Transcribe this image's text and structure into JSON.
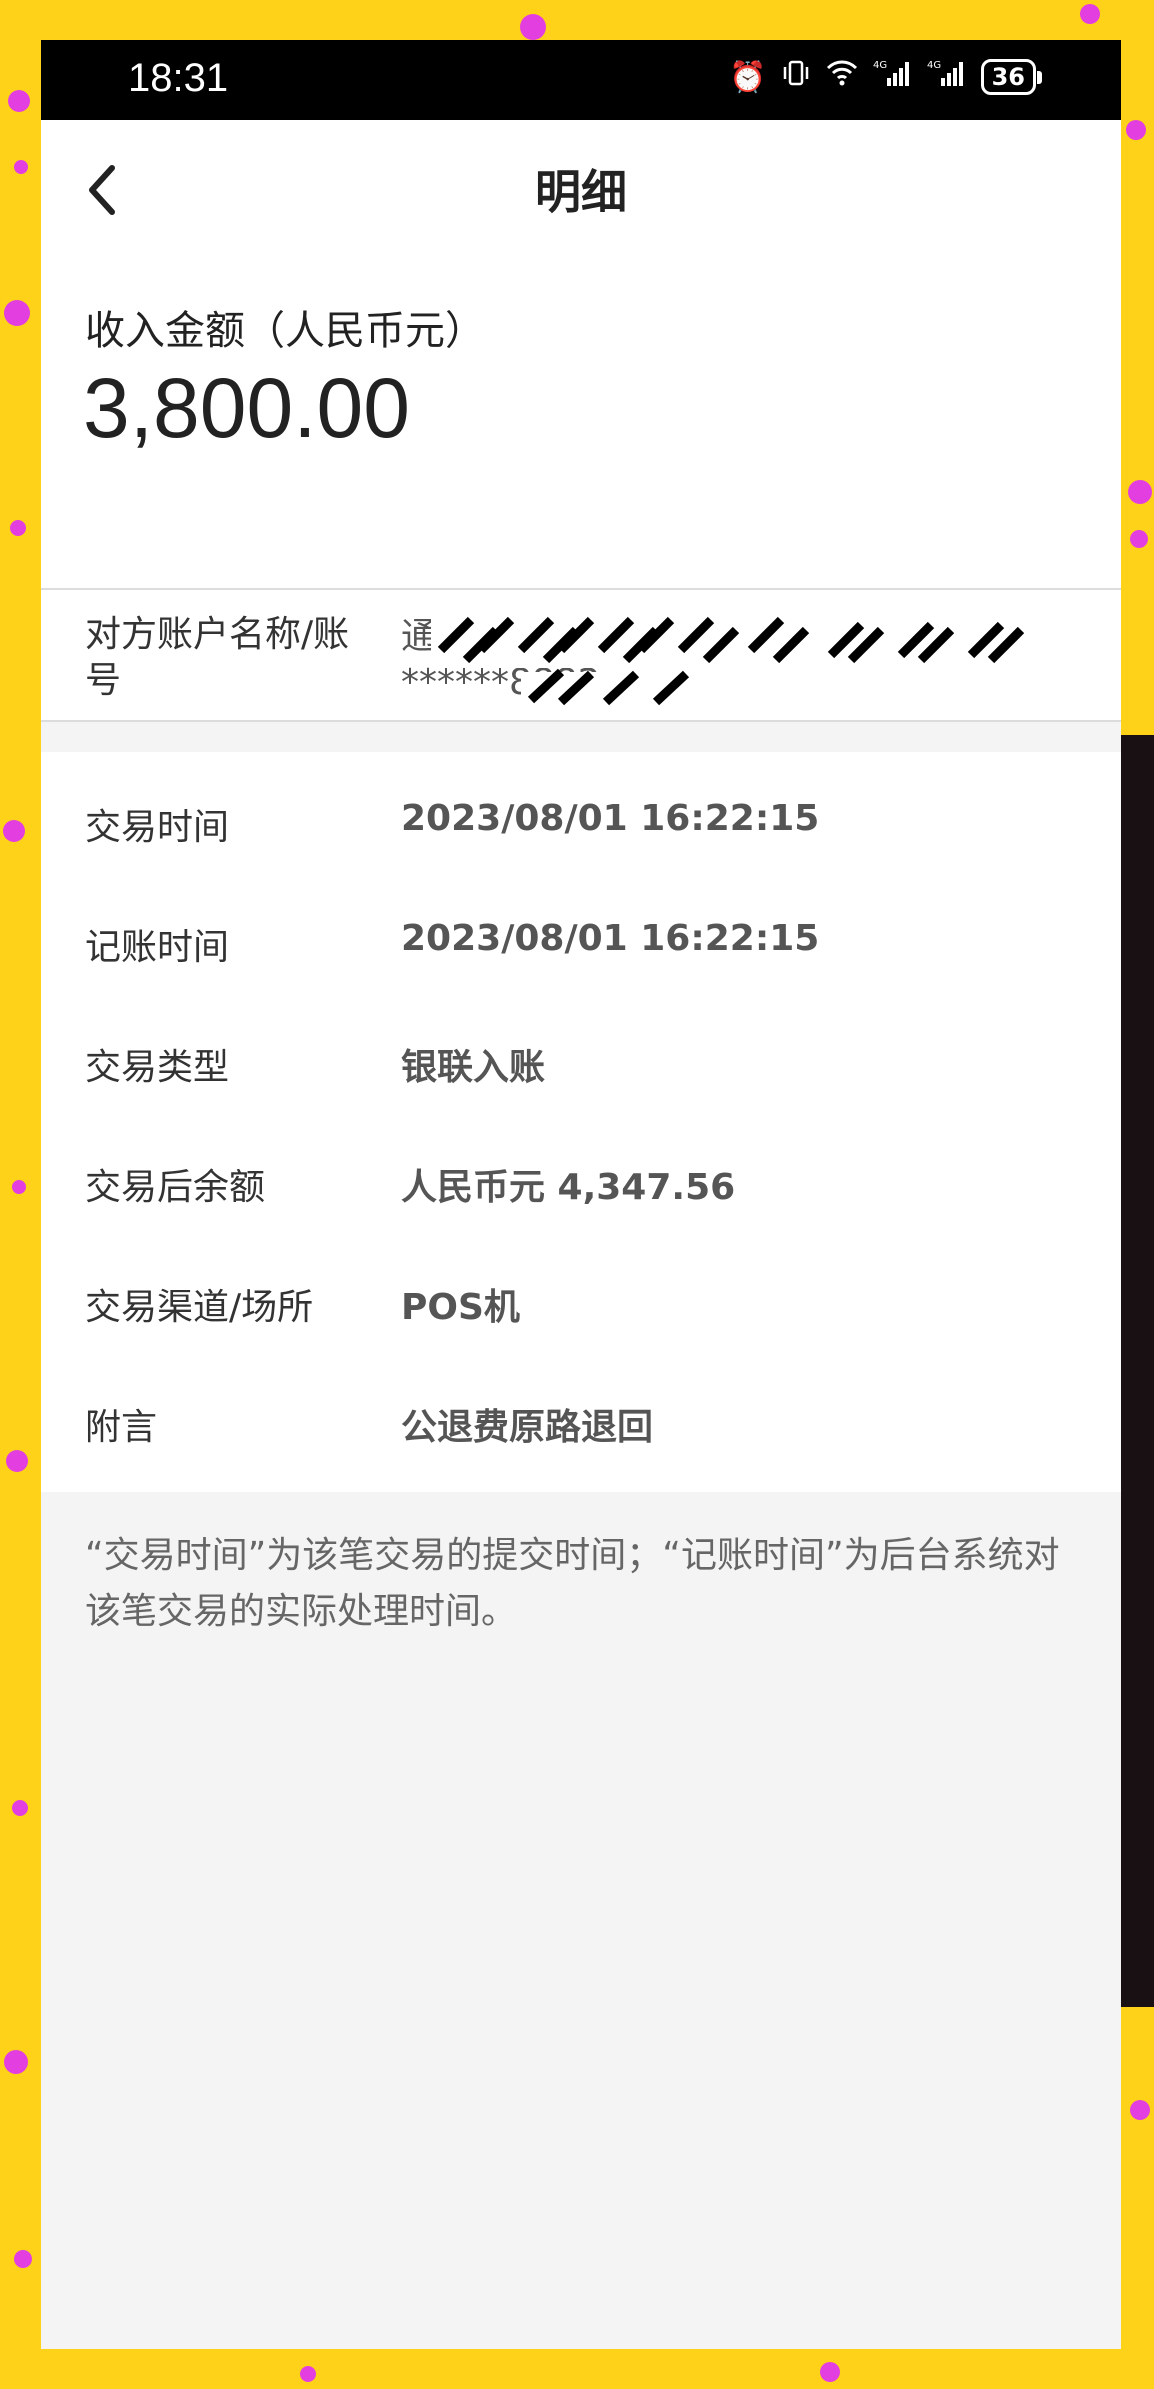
{
  "status_bar": {
    "time": "18:31",
    "icons": [
      "alarm-icon",
      "vibrate-icon",
      "wifi-icon",
      "signal-4g-icon",
      "signal-4g-icon"
    ],
    "battery": "36"
  },
  "nav": {
    "title": "明细"
  },
  "amount": {
    "label": "收入金额（人民币元）",
    "value": "3,800.00"
  },
  "account": {
    "label": "对方账户名称/账号",
    "value": "通联支付网络服务股份有限公司12 ******8882"
  },
  "details": [
    {
      "key": "交易时间",
      "value": "2023/08/01  16:22:15"
    },
    {
      "key": "记账时间",
      "value": "2023/08/01  16:22:15"
    },
    {
      "key": "交易类型",
      "value": "银联入账"
    },
    {
      "key": "交易后余额",
      "value": "人民币元 4,347.56"
    },
    {
      "key": "交易渠道/场所",
      "value": "POS机"
    },
    {
      "key": "附言",
      "value": "公退费原路退回"
    }
  ],
  "footnote": "“交易时间”为该笔交易的提交时间；“记账时间”为后台系统对该笔交易的实际处理时间。",
  "colors": {
    "background_frame": "#ffd21a",
    "decor_dots": "#e33fe0",
    "page": "#f4f4f4"
  }
}
